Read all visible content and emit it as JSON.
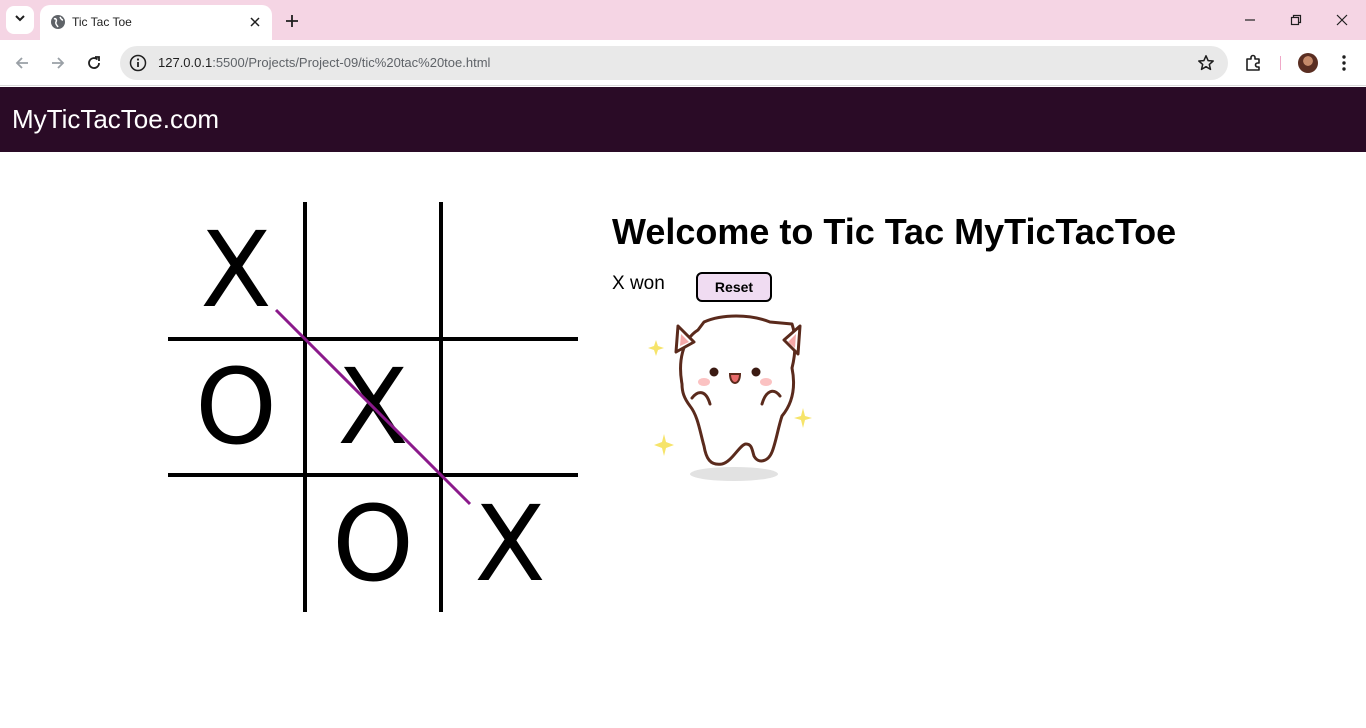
{
  "browser": {
    "tab_title": "Tic Tac Toe",
    "url_host": "127.0.0.1",
    "url_rest": ":5500/Projects/Project-09/tic%20tac%20toe.html"
  },
  "site": {
    "brand": "MyTicTacToe.com"
  },
  "game": {
    "heading": "Welcome to Tic Tac MyTicTacToe",
    "status": "X won",
    "reset_label": "Reset",
    "board": [
      "X",
      "",
      "",
      "O",
      "X",
      "",
      "",
      "O",
      "X"
    ],
    "winning_line": [
      0,
      4,
      8
    ],
    "win_line_color": "#8b1a8b"
  },
  "icons": {
    "tab_search": "chevron-down-icon",
    "favicon": "globe-icon",
    "back": "arrow-left-icon",
    "forward": "arrow-right-icon",
    "reload": "reload-icon",
    "site_info": "info-icon",
    "bookmark": "star-icon",
    "extensions": "puzzle-icon",
    "menu": "kebab-menu-icon",
    "celebration": "dancing-cat-sticker"
  }
}
